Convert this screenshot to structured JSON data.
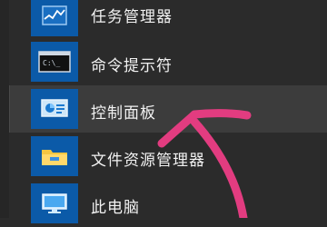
{
  "start_menu": {
    "items": [
      {
        "label": "任务管理器",
        "icon": "task-manager-icon"
      },
      {
        "label": "命令提示符",
        "icon": "command-prompt-icon"
      },
      {
        "label": "控制面板",
        "icon": "control-panel-icon",
        "state": "hovered"
      },
      {
        "label": "文件资源管理器",
        "icon": "file-explorer-icon"
      },
      {
        "label": "此电脑",
        "icon": "this-pc-icon"
      }
    ]
  },
  "annotation": {
    "shape": "pink arrow pointing up-right",
    "color": "#e23c80"
  },
  "colors": {
    "background": "#2b2b2b",
    "tile": "#0b5aa8",
    "hover": "#3c3c3c",
    "text": "#f2f2f2"
  }
}
